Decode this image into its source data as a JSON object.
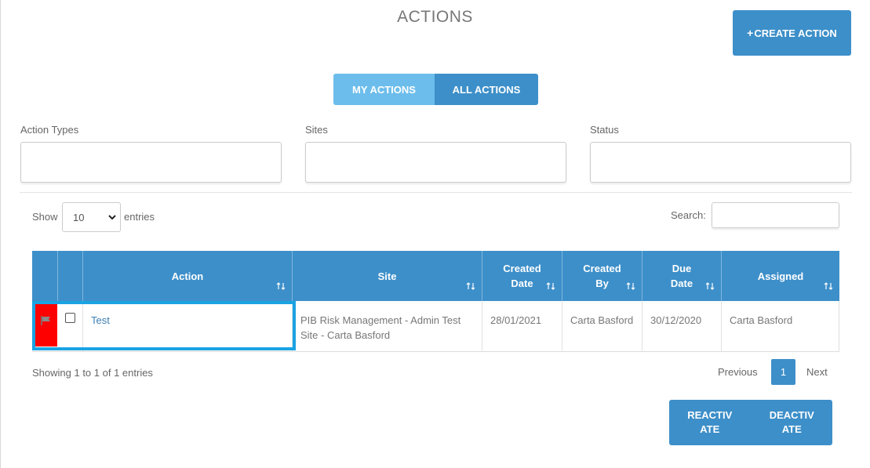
{
  "page": {
    "title": "ACTIONS"
  },
  "header": {
    "create_label": "CREATE ACTION"
  },
  "tabs": [
    {
      "label": "MY ACTIONS"
    },
    {
      "label": "ALL ACTIONS"
    }
  ],
  "filters": [
    {
      "label": "Action Types",
      "value": ""
    },
    {
      "label": "Sites",
      "value": ""
    },
    {
      "label": "Status",
      "value": ""
    }
  ],
  "table_controls": {
    "show_label": "Show",
    "entries_value": "10",
    "entries_label": "entries",
    "search_label": "Search:",
    "search_value": ""
  },
  "table": {
    "columns": [
      "Action",
      "Site",
      "Created Date",
      "Created By",
      "Due Date",
      "Assigned"
    ],
    "rows": [
      {
        "action": "Test",
        "site": "PIB Risk Management - Admin Test Site - Carta Basford",
        "created_date": "28/01/2021",
        "created_by": "Carta Basford",
        "due_date": "30/12/2020",
        "assigned": "Carta Basford",
        "flag_color": "#ff0000"
      }
    ]
  },
  "pagination": {
    "info": "Showing 1 to 1 of 1 entries",
    "previous": "Previous",
    "current_page": "1",
    "next": "Next"
  },
  "bottom_actions": {
    "reactivate": "REACTIVATE",
    "deactivate": "DEACTIVATE"
  },
  "colors": {
    "primary": "#3d8fc9",
    "tab_active_light": "#6cbdeb",
    "flag": "#ff0000",
    "highlight": "#1aa3e3"
  }
}
